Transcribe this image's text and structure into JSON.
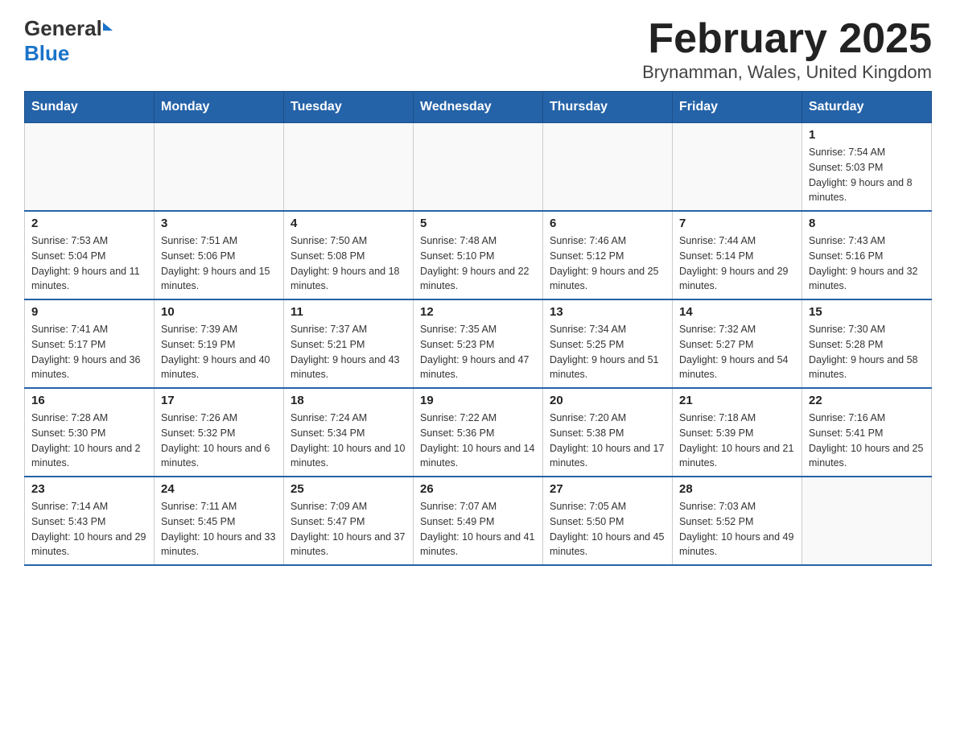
{
  "logo": {
    "name_black": "General",
    "name_blue": "Blue"
  },
  "title": "February 2025",
  "location": "Brynamman, Wales, United Kingdom",
  "days_of_week": [
    "Sunday",
    "Monday",
    "Tuesday",
    "Wednesday",
    "Thursday",
    "Friday",
    "Saturday"
  ],
  "weeks": [
    [
      {
        "day": "",
        "sunrise": "",
        "sunset": "",
        "daylight": ""
      },
      {
        "day": "",
        "sunrise": "",
        "sunset": "",
        "daylight": ""
      },
      {
        "day": "",
        "sunrise": "",
        "sunset": "",
        "daylight": ""
      },
      {
        "day": "",
        "sunrise": "",
        "sunset": "",
        "daylight": ""
      },
      {
        "day": "",
        "sunrise": "",
        "sunset": "",
        "daylight": ""
      },
      {
        "day": "",
        "sunrise": "",
        "sunset": "",
        "daylight": ""
      },
      {
        "day": "1",
        "sunrise": "Sunrise: 7:54 AM",
        "sunset": "Sunset: 5:03 PM",
        "daylight": "Daylight: 9 hours and 8 minutes."
      }
    ],
    [
      {
        "day": "2",
        "sunrise": "Sunrise: 7:53 AM",
        "sunset": "Sunset: 5:04 PM",
        "daylight": "Daylight: 9 hours and 11 minutes."
      },
      {
        "day": "3",
        "sunrise": "Sunrise: 7:51 AM",
        "sunset": "Sunset: 5:06 PM",
        "daylight": "Daylight: 9 hours and 15 minutes."
      },
      {
        "day": "4",
        "sunrise": "Sunrise: 7:50 AM",
        "sunset": "Sunset: 5:08 PM",
        "daylight": "Daylight: 9 hours and 18 minutes."
      },
      {
        "day": "5",
        "sunrise": "Sunrise: 7:48 AM",
        "sunset": "Sunset: 5:10 PM",
        "daylight": "Daylight: 9 hours and 22 minutes."
      },
      {
        "day": "6",
        "sunrise": "Sunrise: 7:46 AM",
        "sunset": "Sunset: 5:12 PM",
        "daylight": "Daylight: 9 hours and 25 minutes."
      },
      {
        "day": "7",
        "sunrise": "Sunrise: 7:44 AM",
        "sunset": "Sunset: 5:14 PM",
        "daylight": "Daylight: 9 hours and 29 minutes."
      },
      {
        "day": "8",
        "sunrise": "Sunrise: 7:43 AM",
        "sunset": "Sunset: 5:16 PM",
        "daylight": "Daylight: 9 hours and 32 minutes."
      }
    ],
    [
      {
        "day": "9",
        "sunrise": "Sunrise: 7:41 AM",
        "sunset": "Sunset: 5:17 PM",
        "daylight": "Daylight: 9 hours and 36 minutes."
      },
      {
        "day": "10",
        "sunrise": "Sunrise: 7:39 AM",
        "sunset": "Sunset: 5:19 PM",
        "daylight": "Daylight: 9 hours and 40 minutes."
      },
      {
        "day": "11",
        "sunrise": "Sunrise: 7:37 AM",
        "sunset": "Sunset: 5:21 PM",
        "daylight": "Daylight: 9 hours and 43 minutes."
      },
      {
        "day": "12",
        "sunrise": "Sunrise: 7:35 AM",
        "sunset": "Sunset: 5:23 PM",
        "daylight": "Daylight: 9 hours and 47 minutes."
      },
      {
        "day": "13",
        "sunrise": "Sunrise: 7:34 AM",
        "sunset": "Sunset: 5:25 PM",
        "daylight": "Daylight: 9 hours and 51 minutes."
      },
      {
        "day": "14",
        "sunrise": "Sunrise: 7:32 AM",
        "sunset": "Sunset: 5:27 PM",
        "daylight": "Daylight: 9 hours and 54 minutes."
      },
      {
        "day": "15",
        "sunrise": "Sunrise: 7:30 AM",
        "sunset": "Sunset: 5:28 PM",
        "daylight": "Daylight: 9 hours and 58 minutes."
      }
    ],
    [
      {
        "day": "16",
        "sunrise": "Sunrise: 7:28 AM",
        "sunset": "Sunset: 5:30 PM",
        "daylight": "Daylight: 10 hours and 2 minutes."
      },
      {
        "day": "17",
        "sunrise": "Sunrise: 7:26 AM",
        "sunset": "Sunset: 5:32 PM",
        "daylight": "Daylight: 10 hours and 6 minutes."
      },
      {
        "day": "18",
        "sunrise": "Sunrise: 7:24 AM",
        "sunset": "Sunset: 5:34 PM",
        "daylight": "Daylight: 10 hours and 10 minutes."
      },
      {
        "day": "19",
        "sunrise": "Sunrise: 7:22 AM",
        "sunset": "Sunset: 5:36 PM",
        "daylight": "Daylight: 10 hours and 14 minutes."
      },
      {
        "day": "20",
        "sunrise": "Sunrise: 7:20 AM",
        "sunset": "Sunset: 5:38 PM",
        "daylight": "Daylight: 10 hours and 17 minutes."
      },
      {
        "day": "21",
        "sunrise": "Sunrise: 7:18 AM",
        "sunset": "Sunset: 5:39 PM",
        "daylight": "Daylight: 10 hours and 21 minutes."
      },
      {
        "day": "22",
        "sunrise": "Sunrise: 7:16 AM",
        "sunset": "Sunset: 5:41 PM",
        "daylight": "Daylight: 10 hours and 25 minutes."
      }
    ],
    [
      {
        "day": "23",
        "sunrise": "Sunrise: 7:14 AM",
        "sunset": "Sunset: 5:43 PM",
        "daylight": "Daylight: 10 hours and 29 minutes."
      },
      {
        "day": "24",
        "sunrise": "Sunrise: 7:11 AM",
        "sunset": "Sunset: 5:45 PM",
        "daylight": "Daylight: 10 hours and 33 minutes."
      },
      {
        "day": "25",
        "sunrise": "Sunrise: 7:09 AM",
        "sunset": "Sunset: 5:47 PM",
        "daylight": "Daylight: 10 hours and 37 minutes."
      },
      {
        "day": "26",
        "sunrise": "Sunrise: 7:07 AM",
        "sunset": "Sunset: 5:49 PM",
        "daylight": "Daylight: 10 hours and 41 minutes."
      },
      {
        "day": "27",
        "sunrise": "Sunrise: 7:05 AM",
        "sunset": "Sunset: 5:50 PM",
        "daylight": "Daylight: 10 hours and 45 minutes."
      },
      {
        "day": "28",
        "sunrise": "Sunrise: 7:03 AM",
        "sunset": "Sunset: 5:52 PM",
        "daylight": "Daylight: 10 hours and 49 minutes."
      },
      {
        "day": "",
        "sunrise": "",
        "sunset": "",
        "daylight": ""
      }
    ]
  ]
}
